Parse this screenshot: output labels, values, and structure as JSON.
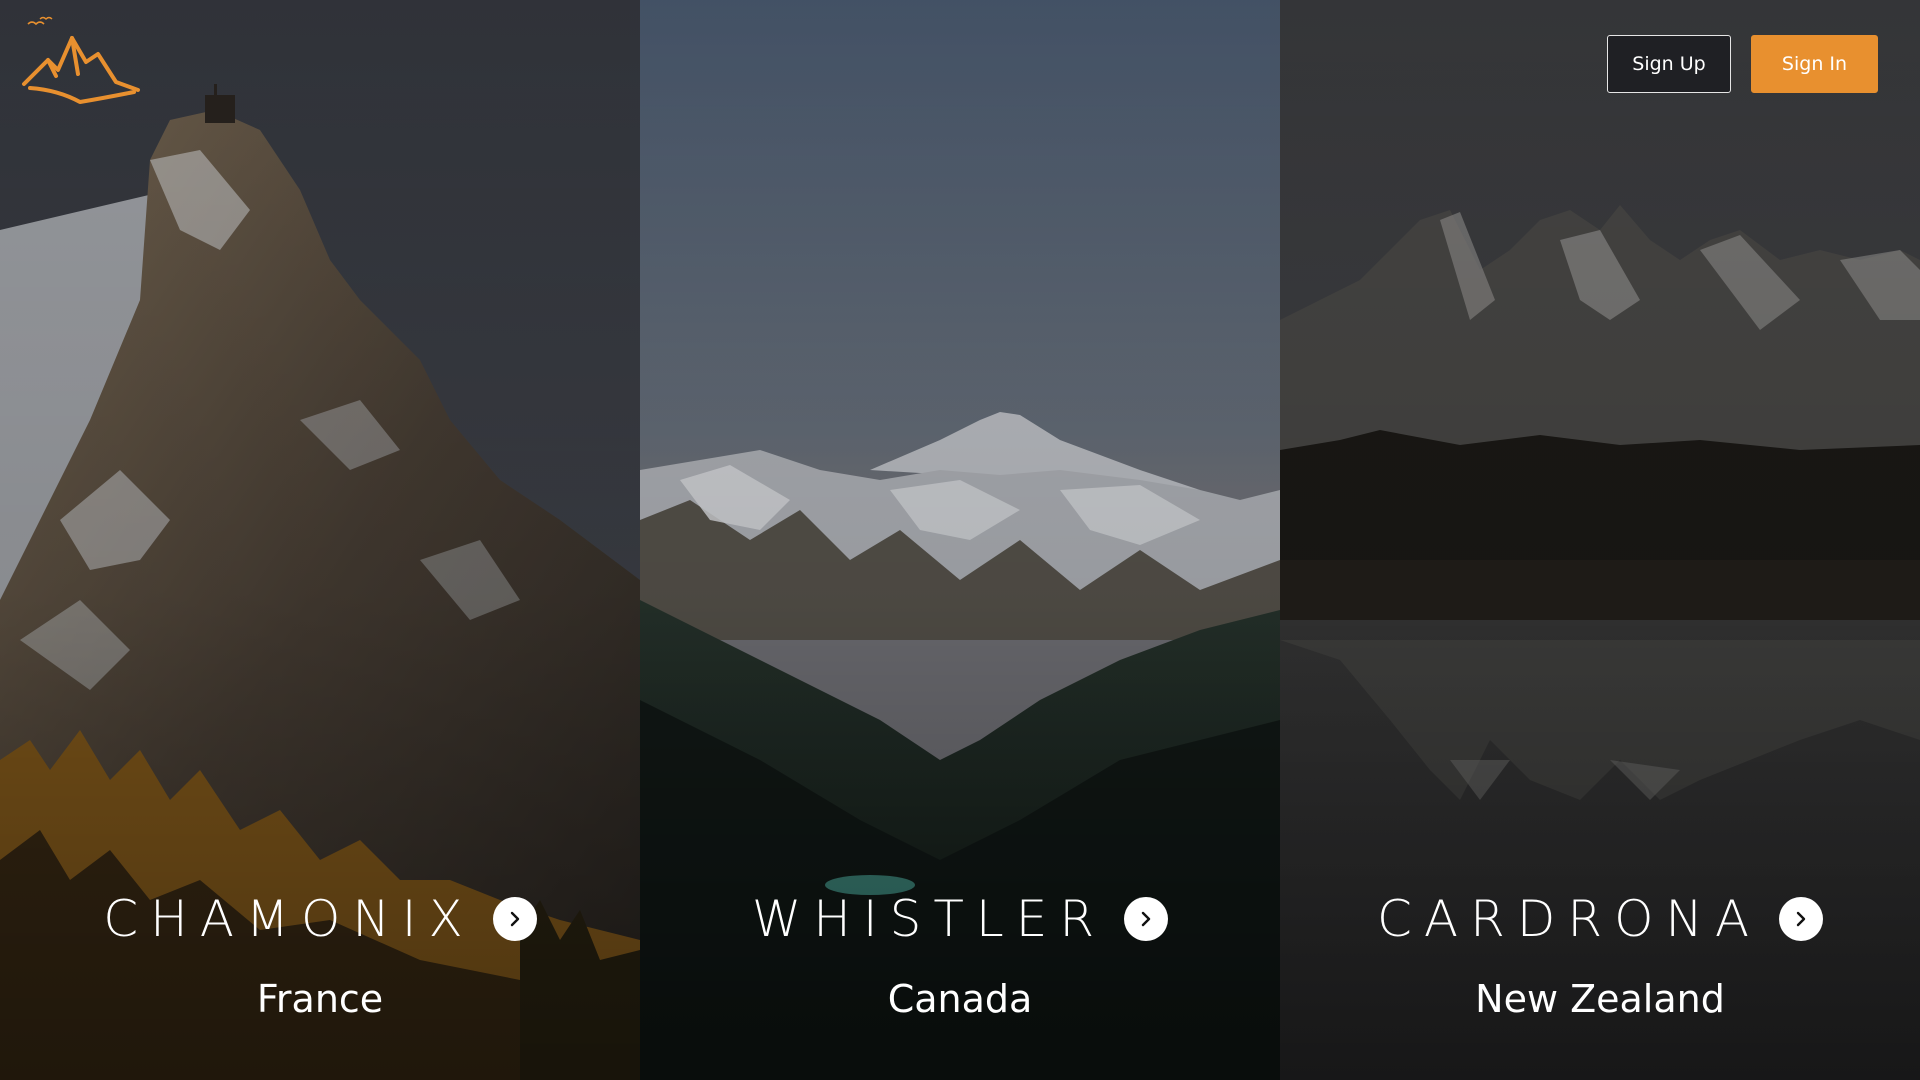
{
  "header": {
    "logo_icon": "mountain-logo-icon",
    "sign_up_label": "Sign Up",
    "sign_in_label": "Sign In"
  },
  "colors": {
    "accent": "#e8902f",
    "sign_up_bg": "#1f2024",
    "text": "#ffffff"
  },
  "destinations": [
    {
      "name": "CHAMONIX",
      "country": "France",
      "icon": "chevron-right-icon"
    },
    {
      "name": "WHISTLER",
      "country": "Canada",
      "icon": "chevron-right-icon"
    },
    {
      "name": "CARDRONA",
      "country": "New Zealand",
      "icon": "chevron-right-icon"
    }
  ]
}
